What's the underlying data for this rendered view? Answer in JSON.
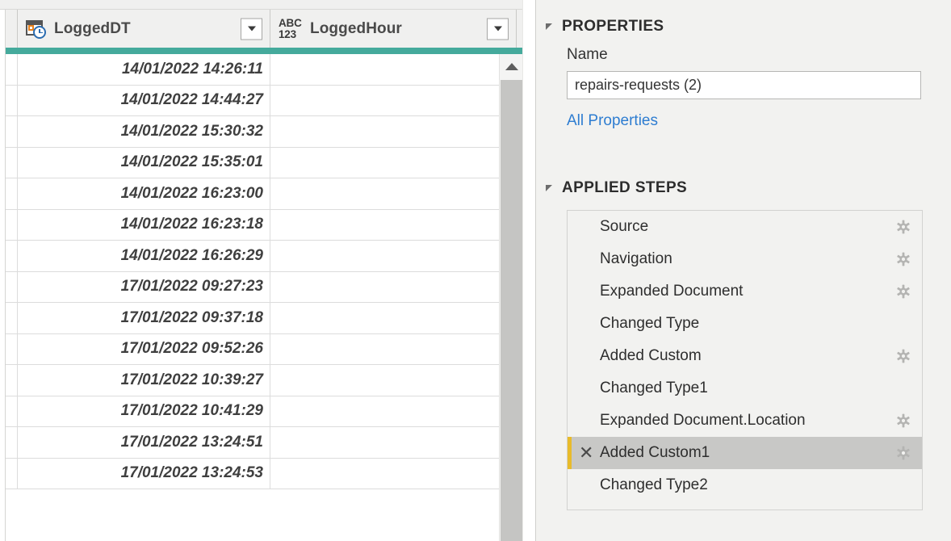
{
  "grid": {
    "columns": [
      {
        "name": "LoggedDT",
        "type_icon": "datetime-type-icon",
        "filter_icon": "chevron-down-icon"
      },
      {
        "name": "LoggedHour",
        "type_icon": "any-type-icon",
        "filter_icon": "chevron-down-icon"
      }
    ],
    "type_icon_abc": "ABC",
    "type_icon_123": "123",
    "rows": [
      {
        "LoggedDT": "14/01/2022 14:26:11",
        "LoggedHour": ""
      },
      {
        "LoggedDT": "14/01/2022 14:44:27",
        "LoggedHour": ""
      },
      {
        "LoggedDT": "14/01/2022 15:30:32",
        "LoggedHour": ""
      },
      {
        "LoggedDT": "14/01/2022 15:35:01",
        "LoggedHour": ""
      },
      {
        "LoggedDT": "14/01/2022 16:23:00",
        "LoggedHour": ""
      },
      {
        "LoggedDT": "14/01/2022 16:23:18",
        "LoggedHour": ""
      },
      {
        "LoggedDT": "14/01/2022 16:26:29",
        "LoggedHour": ""
      },
      {
        "LoggedDT": "17/01/2022 09:27:23",
        "LoggedHour": ""
      },
      {
        "LoggedDT": "17/01/2022 09:37:18",
        "LoggedHour": ""
      },
      {
        "LoggedDT": "17/01/2022 09:52:26",
        "LoggedHour": ""
      },
      {
        "LoggedDT": "17/01/2022 10:39:27",
        "LoggedHour": ""
      },
      {
        "LoggedDT": "17/01/2022 10:41:29",
        "LoggedHour": ""
      },
      {
        "LoggedDT": "17/01/2022 13:24:51",
        "LoggedHour": ""
      },
      {
        "LoggedDT": "17/01/2022 13:24:53",
        "LoggedHour": ""
      }
    ],
    "scrollbar": {
      "up_icon": "chevron-up-icon"
    },
    "accent_color": "#45aa9c"
  },
  "properties": {
    "title": "PROPERTIES",
    "caret_icon": "triangle-expanded-icon",
    "name_label": "Name",
    "name_value": "repairs-requests (2)",
    "name_placeholder": "",
    "all_properties_link": "All Properties",
    "link_color": "#2e7dd1"
  },
  "applied_steps": {
    "title": "APPLIED STEPS",
    "caret_icon": "triangle-expanded-icon",
    "selected_marker_color": "#e8bb2b",
    "delete_icon": "close-x-icon",
    "gear_icon": "gear-icon",
    "steps": [
      {
        "label": "Source",
        "has_gear": true,
        "selected": false
      },
      {
        "label": "Navigation",
        "has_gear": true,
        "selected": false
      },
      {
        "label": "Expanded Document",
        "has_gear": true,
        "selected": false
      },
      {
        "label": "Changed Type",
        "has_gear": false,
        "selected": false
      },
      {
        "label": "Added Custom",
        "has_gear": true,
        "selected": false
      },
      {
        "label": "Changed Type1",
        "has_gear": false,
        "selected": false
      },
      {
        "label": "Expanded Document.Location",
        "has_gear": true,
        "selected": false
      },
      {
        "label": "Added Custom1",
        "has_gear": true,
        "selected": true
      },
      {
        "label": "Changed Type2",
        "has_gear": false,
        "selected": false
      }
    ]
  }
}
